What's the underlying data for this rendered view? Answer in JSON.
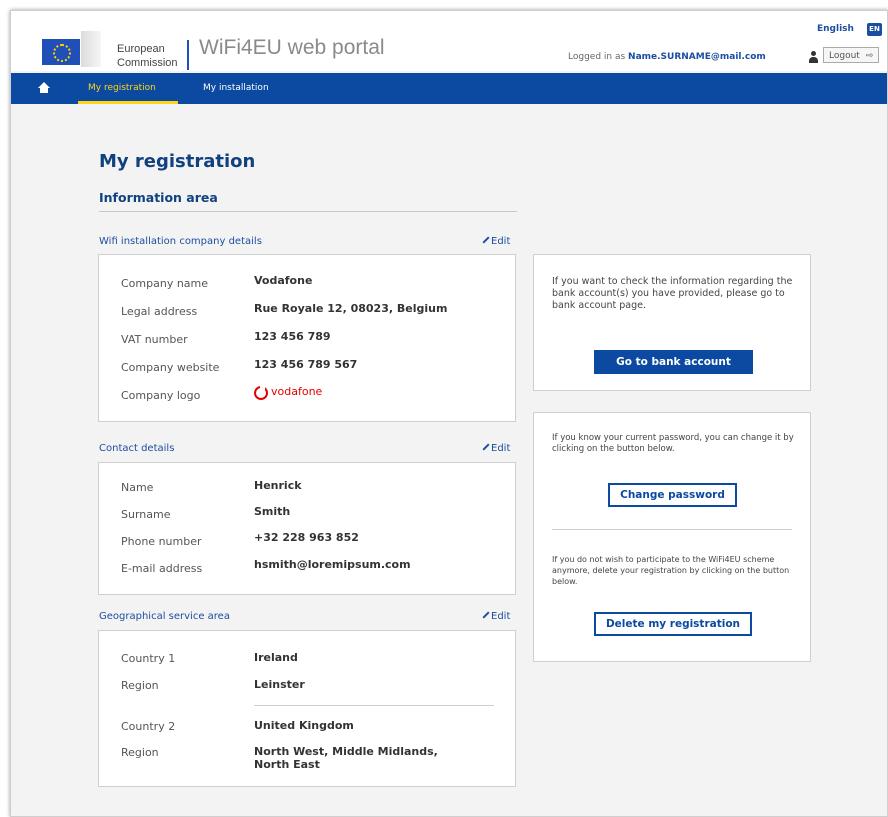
{
  "header": {
    "commission_line1": "European",
    "commission_line2": "Commission",
    "portal_title": "WiFi4EU web portal",
    "logged_in_prefix": "Logged in as",
    "logged_in_user": "Name.SURNAME@mail.com",
    "language_label": "English",
    "language_code": "EN",
    "logout_label": "Logout"
  },
  "nav": {
    "home_icon": "home-icon",
    "tabs": [
      {
        "label": "My registration"
      },
      {
        "label": "My installation"
      }
    ]
  },
  "page": {
    "title": "My registration",
    "information_area": "Information area"
  },
  "company": {
    "section_label": "Wifi installation company details",
    "edit_label": "Edit",
    "rows": [
      {
        "label": "Company name",
        "value": "Vodafone"
      },
      {
        "label": "Legal address",
        "value": "Rue Royale 12, 08023, Belgium"
      },
      {
        "label": "VAT number",
        "value": "123 456 789"
      },
      {
        "label": "Company website",
        "value": "123 456 789 567"
      }
    ],
    "logo_label": "Company logo",
    "logo_text": "vodafone"
  },
  "contact": {
    "section_label": "Contact details",
    "edit_label": "Edit",
    "rows": [
      {
        "label": "Name",
        "value": "Henrick"
      },
      {
        "label": "Surname",
        "value": "Smith"
      },
      {
        "label": "Phone number",
        "value": "+32 228 963 852"
      },
      {
        "label": "E-mail address",
        "value": "hsmith@loremipsum.com"
      }
    ]
  },
  "geo": {
    "section_label": "Geographical service area",
    "edit_label": "Edit",
    "rows": [
      {
        "label": "Country 1",
        "value": "Ireland"
      },
      {
        "label": "Region",
        "value": "Leinster"
      },
      {
        "label": "Country 2",
        "value": "United Kingdom"
      },
      {
        "label": "Region",
        "value": "North West, Middle Midlands,\nNorth East"
      }
    ]
  },
  "bank": {
    "text": "If you want to check the information regarding the bank account(s) you have provided, please go to bank account page.",
    "button": "Go to bank account"
  },
  "password": {
    "text": "If you know your current password, you can change it by clicking on the button below.",
    "button": "Change password"
  },
  "delete": {
    "text": "If you do not wish to participate to the WiFi4EU scheme anymore, delete your registration by clicking on the button below.",
    "button": "Delete my registration"
  },
  "colors": {
    "primary": "#0b4aa0",
    "accent": "#ffd617",
    "vodafone_red": "#e60000"
  }
}
